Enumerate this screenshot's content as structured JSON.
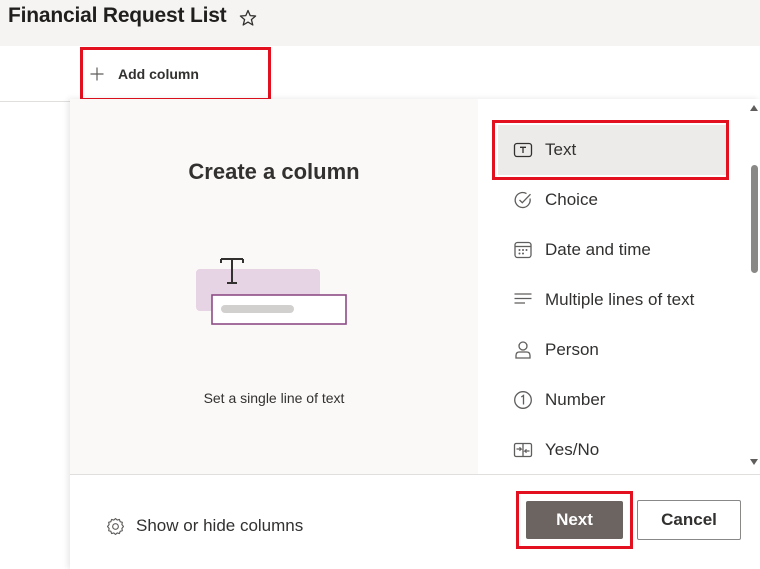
{
  "header": {
    "title": "Financial Request List",
    "favorite_icon": "star-outline-icon"
  },
  "command_bar": {
    "add_column_label": "Add column",
    "add_column_icon": "plus-icon"
  },
  "panel": {
    "preview_title": "Create a column",
    "preview_description": "Set a single line of text",
    "column_types": [
      {
        "label": "Text",
        "icon": "text-icon",
        "selected": true
      },
      {
        "label": "Choice",
        "icon": "checkmark-circle-icon",
        "selected": false
      },
      {
        "label": "Date and time",
        "icon": "calendar-icon",
        "selected": false
      },
      {
        "label": "Multiple lines of text",
        "icon": "lines-icon",
        "selected": false
      },
      {
        "label": "Person",
        "icon": "person-icon",
        "selected": false
      },
      {
        "label": "Number",
        "icon": "number-icon",
        "selected": false
      },
      {
        "label": "Yes/No",
        "icon": "toggle-icon",
        "selected": false
      }
    ]
  },
  "footer": {
    "show_hide_label": "Show or hide columns",
    "next_label": "Next",
    "cancel_label": "Cancel"
  },
  "colors": {
    "highlight_outline": "#e3101f",
    "next_button": "#6b6461",
    "selected_item_bg": "#edebe9",
    "illustration_accent": "#8e4c86"
  }
}
